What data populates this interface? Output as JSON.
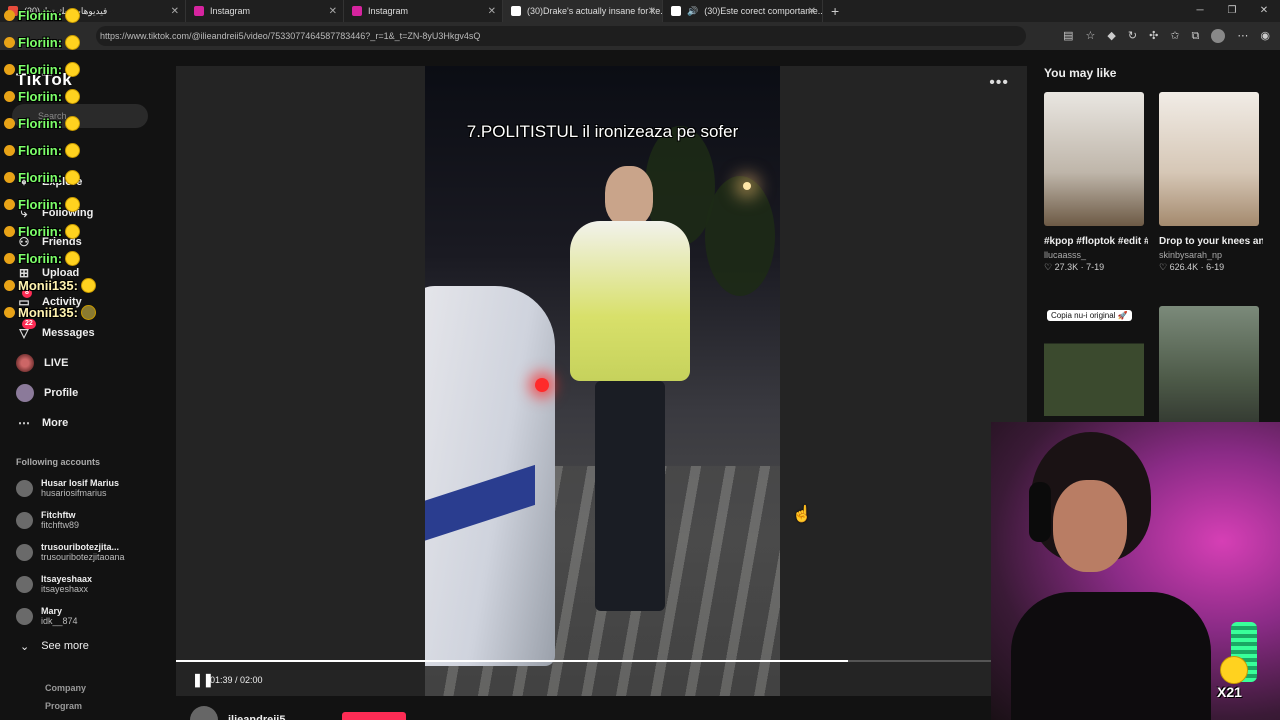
{
  "browser": {
    "tabs": [
      {
        "label": "(30)فيديوهات تيك توك",
        "icon_color": "#e74c3c"
      },
      {
        "label": "Instagram",
        "icon_color": "#d6249f"
      },
      {
        "label": "Instagram",
        "icon_color": "#d6249f"
      },
      {
        "label": "(30)Drake's actually insane for ke...",
        "icon_color": "#ffffff"
      },
      {
        "label": "(30)Este corect comportame...",
        "icon_color": "#ffffff"
      }
    ],
    "url": "https://www.tiktok.com/@ilieandreii5/video/7533077464587783446?_r=1&_t=ZN-8yU3Hkgv4sQ"
  },
  "sidebar": {
    "logo": "TikTok",
    "search_placeholder": "Search",
    "nav": [
      {
        "label": "Explore",
        "icon": "compass-icon"
      },
      {
        "label": "Following",
        "icon": "following-icon"
      },
      {
        "label": "Friends",
        "icon": "friends-icon"
      },
      {
        "label": "Upload",
        "icon": "upload-icon"
      },
      {
        "label": "Activity",
        "icon": "activity-icon",
        "badge": "8"
      },
      {
        "label": "Messages",
        "icon": "messages-icon",
        "badge": "22"
      },
      {
        "label": "LIVE",
        "icon": "live-icon"
      },
      {
        "label": "Profile",
        "icon": "profile-icon"
      },
      {
        "label": "More",
        "icon": "more-icon"
      }
    ],
    "following_title": "Following accounts",
    "accounts": [
      {
        "name": "Husar Iosif Marius",
        "user": "husariosifmarius"
      },
      {
        "name": "Fitchftw",
        "user": "fitchftw89"
      },
      {
        "name": "trusouribotezjita...",
        "user": "trusouribotezjitaoana"
      },
      {
        "name": "Itsayeshaax",
        "user": "itsayeshaxx"
      },
      {
        "name": "Mary",
        "user": "idk__874"
      }
    ],
    "see_more": "See more",
    "footer": [
      "Company",
      "Program"
    ]
  },
  "chat": [
    {
      "user": "Floriin:",
      "color": "#7dff6a"
    },
    {
      "user": "Floriin:",
      "color": "#7dff6a"
    },
    {
      "user": "Floriin:",
      "color": "#7dff6a"
    },
    {
      "user": "Floriin:",
      "color": "#7dff6a"
    },
    {
      "user": "Floriin:",
      "color": "#7dff6a"
    },
    {
      "user": "Floriin:",
      "color": "#7dff6a"
    },
    {
      "user": "Floriin:",
      "color": "#7dff6a"
    },
    {
      "user": "Floriin:",
      "color": "#7dff6a"
    },
    {
      "user": "Floriin:",
      "color": "#7dff6a"
    },
    {
      "user": "Floriin:",
      "color": "#7dff6a"
    },
    {
      "user": "Monii135:",
      "color": "#fff3b0"
    },
    {
      "user": "Monii135:",
      "color": "#fff3b0"
    }
  ],
  "video": {
    "caption": "7.POLITISTUL il ironizeaza pe sofer",
    "time": "01:39 / 02:00",
    "progress": 0.825,
    "author": "ilieandreii5"
  },
  "recommend": {
    "title": "You may like",
    "cards": [
      {
        "desc": "#kpop #floptok #edit #kpopedit...",
        "user": "llucaasss_",
        "stats": "♡ 27.3K · 7-19",
        "bg": "#c9c4bd"
      },
      {
        "desc": "Drop to your knees and bark like you...",
        "user": "skinbysarah_np",
        "stats": "♡ 626.4K · 6-19",
        "bg": "#d9cfc4"
      },
      {
        "label": "Copia nu-i original 🚀",
        "bg": "#3b4a2e"
      },
      {
        "bg": "#5a6a5a"
      }
    ]
  },
  "webcam": {
    "badge": "X21"
  }
}
